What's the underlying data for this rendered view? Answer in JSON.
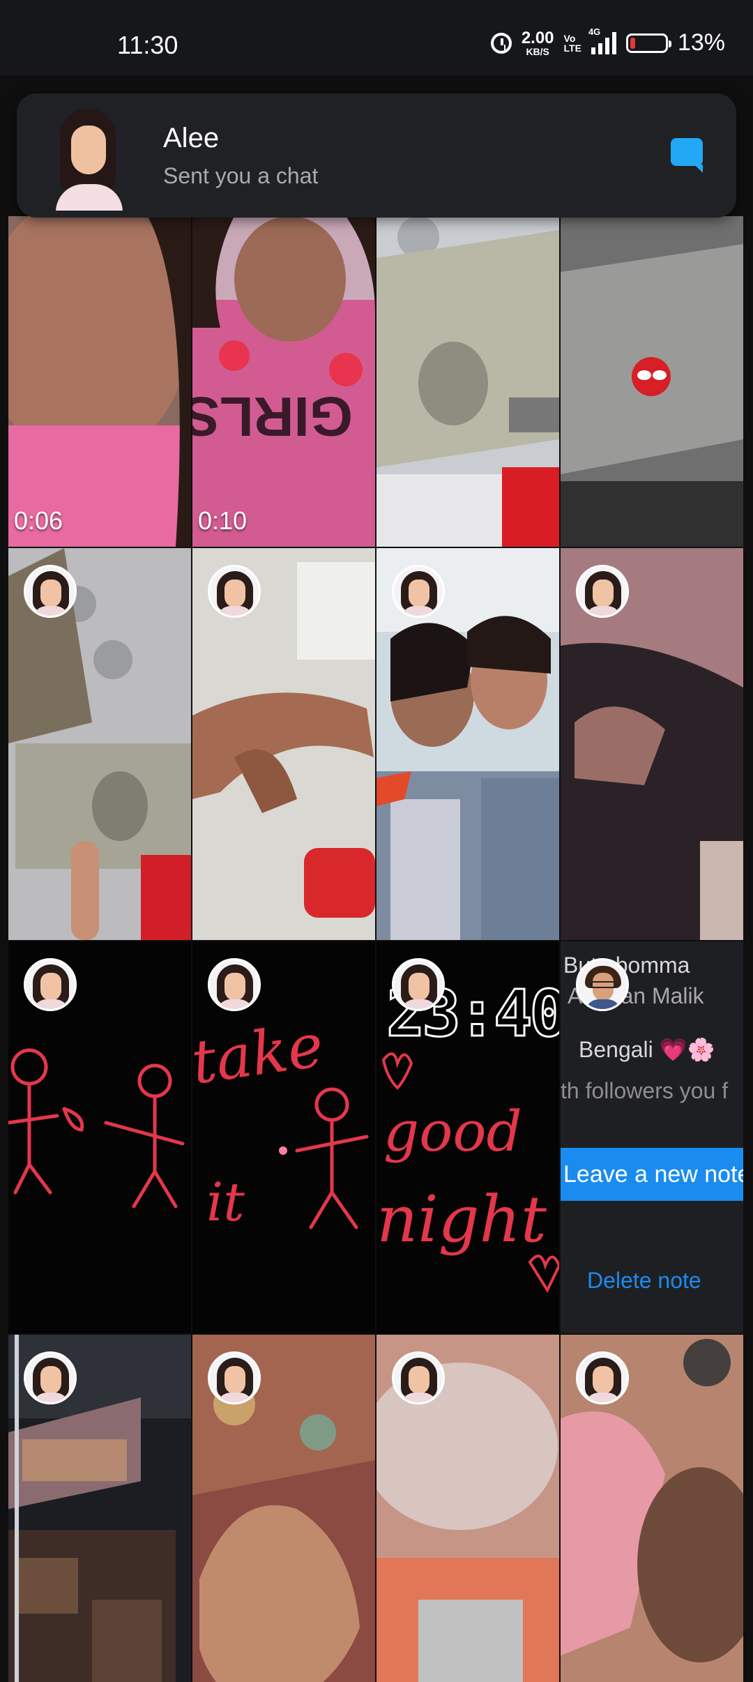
{
  "status_bar": {
    "time": "11:30",
    "net_speed_value": "2.00",
    "net_speed_unit": "KB/S",
    "volte_top": "Vo",
    "volte_bottom": "LTE",
    "network_type": "4G",
    "battery_percent": "13%",
    "battery_level": 0.13,
    "battery_color": "#e53935"
  },
  "notification": {
    "sender": "Alee",
    "message": "Sent you a chat",
    "icon": "chat-icon",
    "accent": "#22a8f4"
  },
  "grid": {
    "video_durations": [
      "0:06",
      "0:10"
    ],
    "clock_sticker": "23:40",
    "drawing_texts": [
      "take",
      "it",
      "good",
      "night"
    ],
    "note_card": {
      "song_line": "Buttabomma",
      "artist_line": "Armaan Malik",
      "tag_line": "Bengali 💗🌸",
      "followers_line": "th followers you f",
      "leave_note_label": "Leave a new note",
      "delete_note_label": "Delete note"
    }
  },
  "colors": {
    "background": "#0f0f10",
    "card": "#202124",
    "blue_accent": "#1a8cf0"
  }
}
